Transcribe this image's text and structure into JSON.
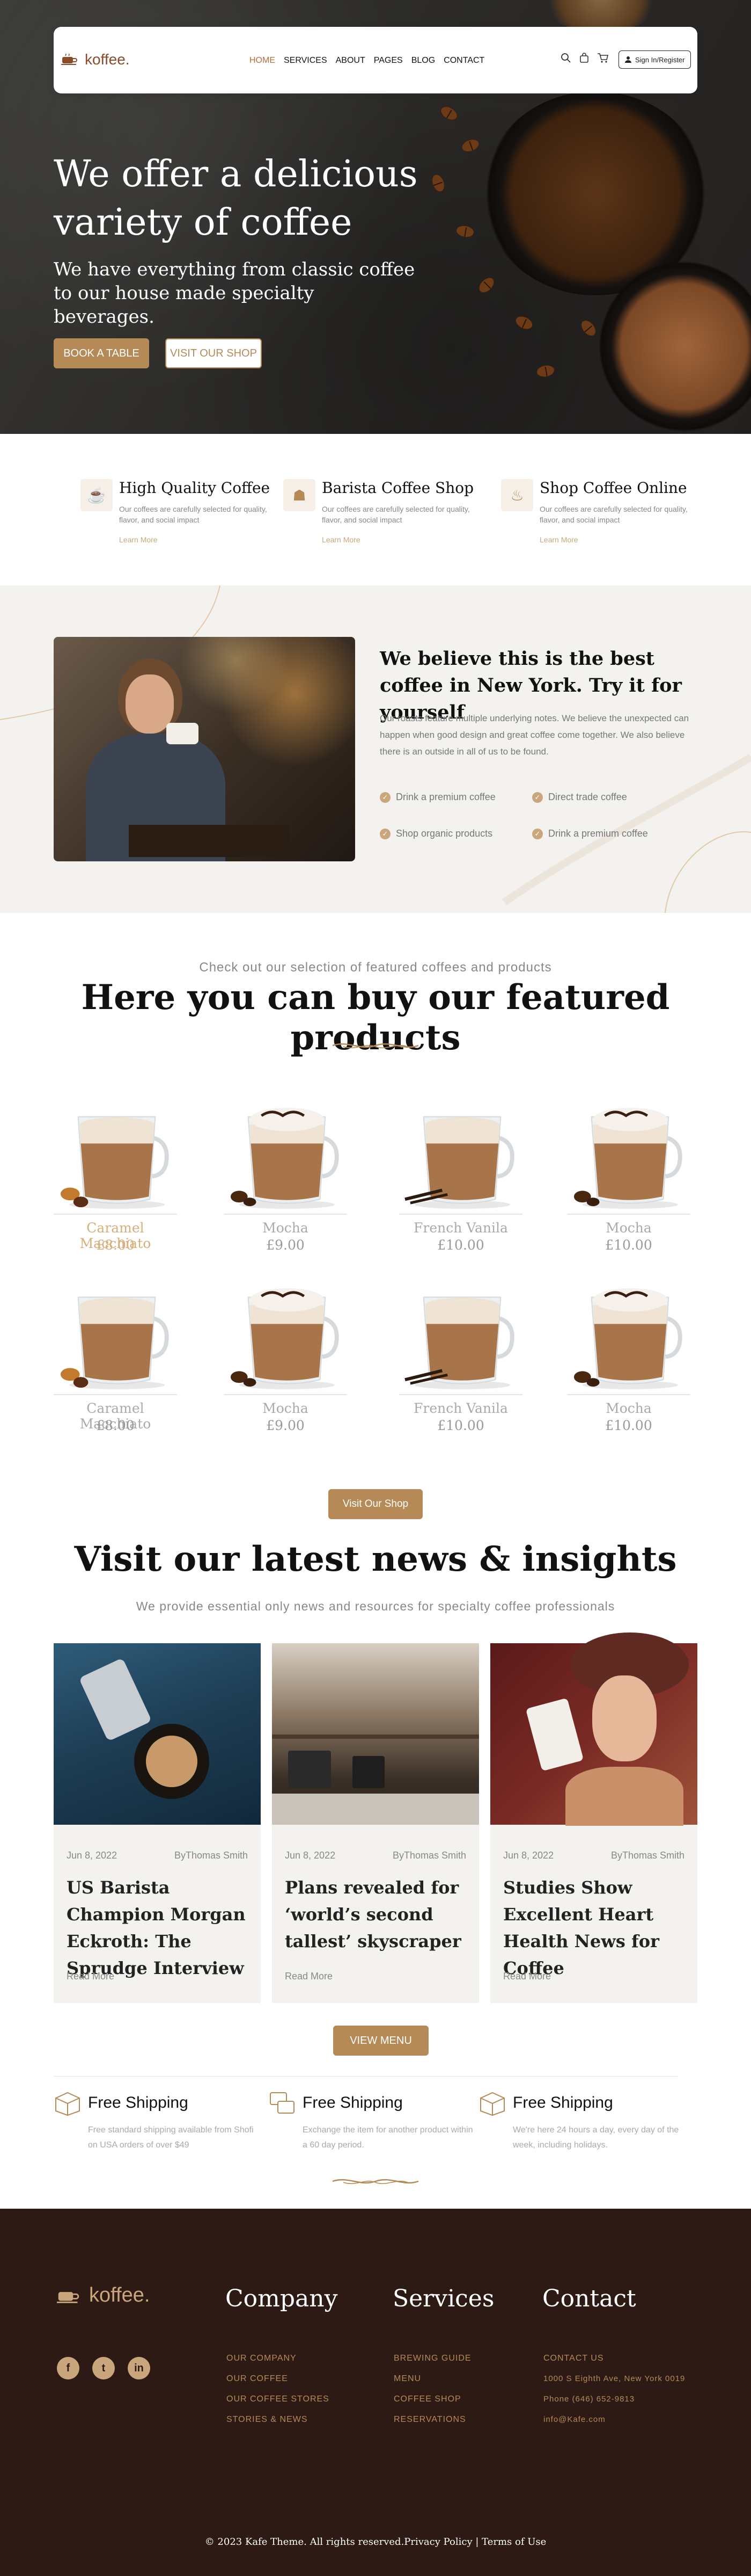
{
  "brand": {
    "name": "koffee."
  },
  "nav": {
    "items": [
      "HOME",
      "SERVICES",
      "ABOUT",
      "PAGES",
      "BLOG",
      "CONTACT"
    ],
    "signin": "Sign In/Register"
  },
  "hero": {
    "title": "We offer a delicious variety of coffee",
    "subtitle": "We have everything from classic coffee to our house made specialty beverages.",
    "btn_table": "BOOK A TABLE",
    "btn_shop": "VISIT OUR SHOP"
  },
  "features": [
    {
      "icon": "coffee-beans-icon",
      "title": "High Quality Coffee",
      "desc": "Our coffees are carefully selected for quality, flavor, and social impact",
      "link": "Learn More"
    },
    {
      "icon": "barista-icon",
      "title": "Barista Coffee Shop",
      "desc": "Our coffees are carefully selected for quality, flavor, and social impact",
      "link": "Learn More"
    },
    {
      "icon": "coffee-machine-icon",
      "title": "Shop Coffee Online",
      "desc": "Our coffees are carefully selected for quality, flavor, and social impact",
      "link": "Learn More"
    }
  ],
  "about": {
    "title": "We believe this is the best coffee in New York. Try it for yourself",
    "text": "Our roasts feature multiple underlying notes. We believe the unexpected can happen when good design and great coffee come together. We also believe there is an outside in all of us to be found.",
    "checks": [
      "Drink a premium coffee",
      "Direct trade coffee",
      "Shop organic products",
      "Drink a premium coffee"
    ]
  },
  "products": {
    "kicker": "Check out our selection of featured coffees and products",
    "title": "Here you can buy our featured products",
    "items": [
      {
        "name": "Caramel Macchiato",
        "price": "£8.00"
      },
      {
        "name": "Mocha",
        "price": "£9.00"
      },
      {
        "name": "French Vanila",
        "price": "£10.00"
      },
      {
        "name": "Mocha",
        "price": "£10.00"
      },
      {
        "name": "Caramel Macchiato",
        "price": "£8.00"
      },
      {
        "name": "Mocha",
        "price": "£9.00"
      },
      {
        "name": "French Vanila",
        "price": "£10.00"
      },
      {
        "name": "Mocha",
        "price": "£10.00"
      }
    ],
    "shop_btn": "Visit Our Shop"
  },
  "news": {
    "title": "Visit our latest news & insights",
    "subtitle": "We provide essential only news and resources for specialty coffee professionals",
    "cards": [
      {
        "date": "Jun 8, 2022",
        "by": "ByThomas Smith",
        "title": "US Barista Champion Morgan Eckroth: The Sprudge Interview",
        "more": "Read More"
      },
      {
        "date": "Jun 8, 2022",
        "by": "ByThomas Smith",
        "title": "Plans revealed for ‘world’s second tallest’ skyscraper",
        "more": "Read More"
      },
      {
        "date": "Jun 8, 2022",
        "by": "ByThomas Smith",
        "title": "Studies Show Excellent Heart Health News for Coffee",
        "more": "Read More"
      }
    ],
    "menu_btn": "VIEW MENU"
  },
  "shipping": [
    {
      "title": "Free Shipping",
      "desc": "Free standard shipping available from Shofi on USA orders of over $49"
    },
    {
      "title": "Free Shipping",
      "desc": "Exchange the item for another product within a 60 day period."
    },
    {
      "title": "Free Shipping",
      "desc": "We're here 24 hours a day, every day of the week, including holidays."
    }
  ],
  "footer": {
    "company": {
      "title": "Company",
      "links": [
        "OUR COMPANY",
        "OUR COFFEE",
        "OUR COFFEE STORES",
        "STORIES & NEWS"
      ]
    },
    "services": {
      "title": "Services",
      "links": [
        "BREWING GUIDE",
        "MENU",
        "COFFEE SHOP",
        "RESERVATIONS"
      ]
    },
    "contact": {
      "title": "Contact",
      "links": [
        "CONTACT US",
        "1000 S Eighth Ave, New York 0019",
        "Phone (646) 652-9813",
        "info@Kafe.com"
      ]
    },
    "social": [
      "f",
      "t",
      "in"
    ],
    "copyright": "© 2023 Kafe Theme. All rights reserved.Privacy Policy | Terms of Use"
  },
  "colors": {
    "accent": "#b58a57",
    "dark": "#2e1a14",
    "highlight": "#d8ae7b"
  }
}
